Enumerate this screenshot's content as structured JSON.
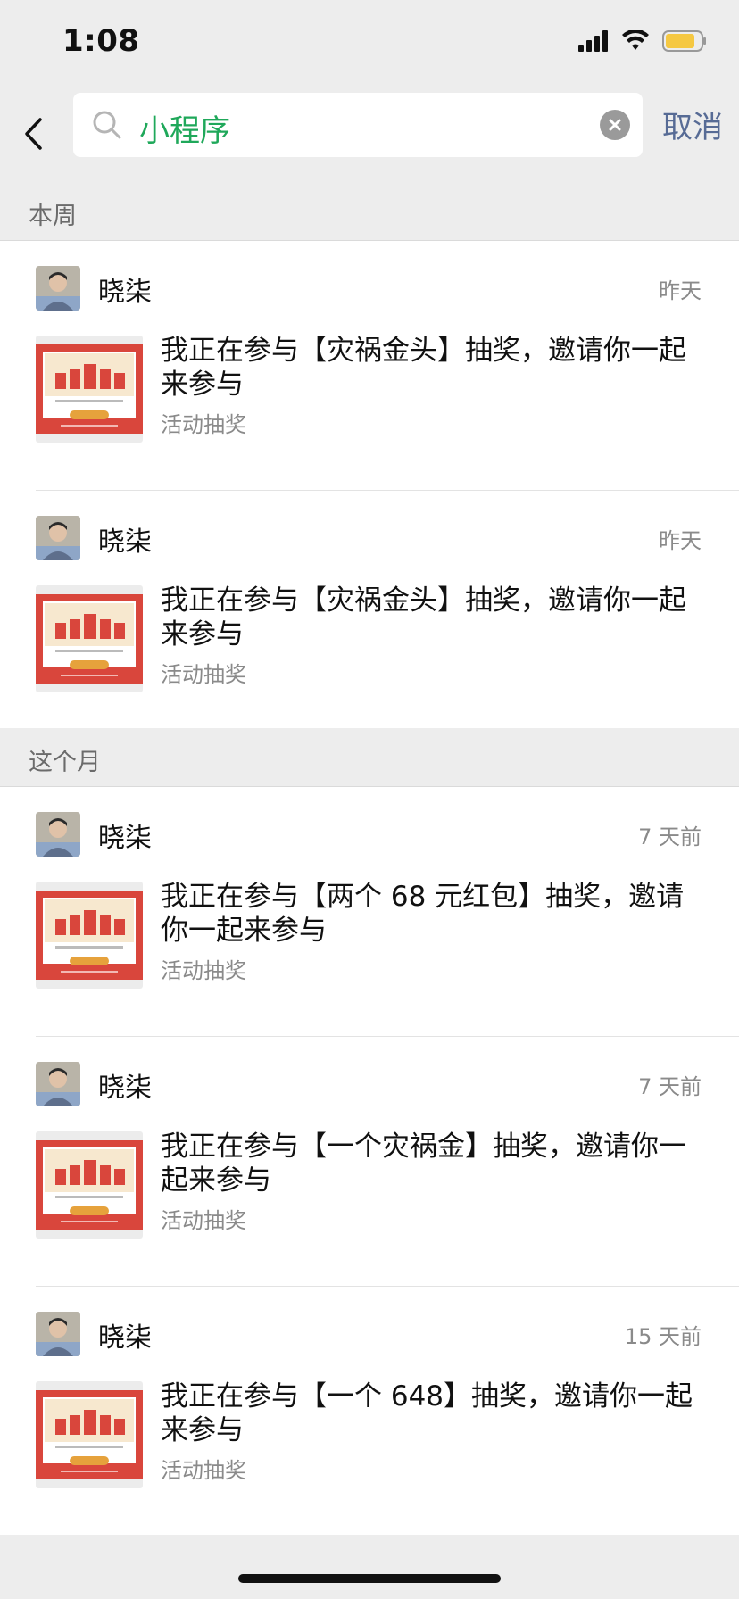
{
  "status_bar": {
    "time": "1:08",
    "signal_icon": "cellular-signal-icon",
    "wifi_icon": "wifi-icon",
    "battery_icon": "battery-icon",
    "battery_color": "#f5c842"
  },
  "header": {
    "back_icon": "chevron-left-icon",
    "search_icon": "search-icon",
    "search_value": "小程序",
    "search_color": "#1fa85a",
    "clear_icon": "clear-icon",
    "cancel_label": "取消",
    "cancel_color": "#576b95"
  },
  "sections": [
    {
      "label": "本周",
      "items": [
        {
          "sender": "晓柒",
          "time": "昨天",
          "title": "我正在参与【灾祸金头】抽奖，邀请你一起来参与",
          "source": "活动抽奖"
        },
        {
          "sender": "晓柒",
          "time": "昨天",
          "title": "我正在参与【灾祸金头】抽奖，邀请你一起来参与",
          "source": "活动抽奖"
        }
      ]
    },
    {
      "label": "这个月",
      "items": [
        {
          "sender": "晓柒",
          "time": "7 天前",
          "title": "我正在参与【两个 68 元红包】抽奖，邀请你一起来参与",
          "source": "活动抽奖"
        },
        {
          "sender": "晓柒",
          "time": "7 天前",
          "title": "我正在参与【一个灾祸金】抽奖，邀请你一起来参与",
          "source": "活动抽奖"
        },
        {
          "sender": "晓柒",
          "time": "15 天前",
          "title": "我正在参与【一个 648】抽奖，邀请你一起来参与",
          "source": "活动抽奖"
        }
      ]
    }
  ],
  "thumbnail_icon": "lottery-card-thumbnail",
  "avatar_icon": "user-avatar",
  "accent_red": "#d9463c"
}
